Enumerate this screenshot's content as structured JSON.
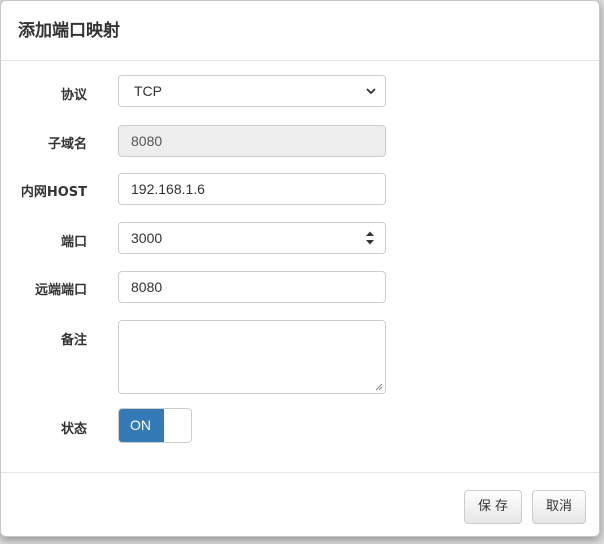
{
  "dialog": {
    "title": "添加端口映射"
  },
  "form": {
    "protocol": {
      "label": "协议",
      "value": "TCP"
    },
    "subdomain": {
      "label": "子域名",
      "value": "8080"
    },
    "lan_host": {
      "label": "内网HOST",
      "value": "192.168.1.6"
    },
    "port": {
      "label": "端口",
      "value": "3000"
    },
    "remote_port": {
      "label": "远端端口",
      "value": "8080"
    },
    "remark": {
      "label": "备注",
      "value": ""
    },
    "status": {
      "label": "状态",
      "toggle_label": "ON",
      "on": true,
      "on_color": "#337ab7"
    }
  },
  "footer": {
    "save_label": "保存",
    "cancel_label": "取消"
  }
}
